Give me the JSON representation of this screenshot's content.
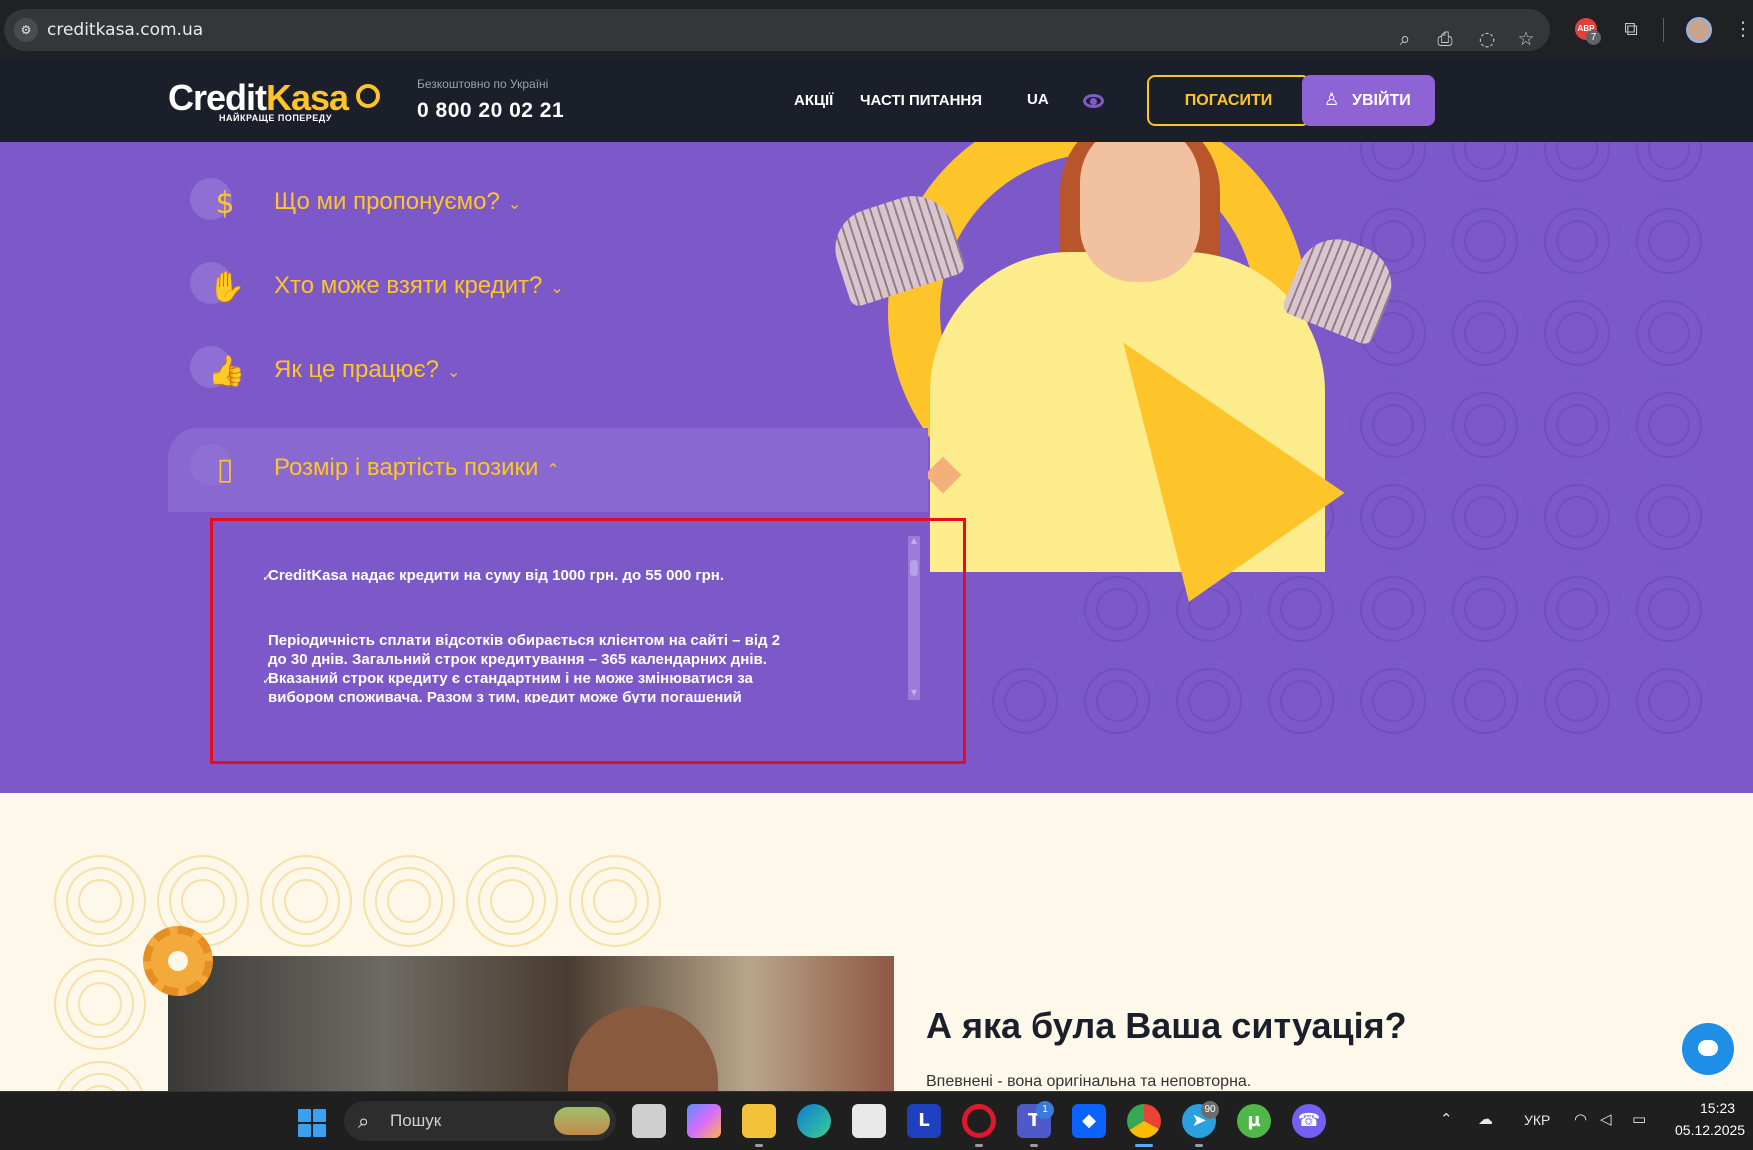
{
  "browser": {
    "url": "creditkasa.com.ua",
    "extension_badge_label": "ABP",
    "extension_badge_count": "7"
  },
  "header": {
    "logo_credit": "Credit",
    "logo_kasa": "Kasa",
    "logo_tagline": "НАЙКРАЩЕ ПОПЕРЕДУ",
    "free_label": "Безкоштовно по Україні",
    "phone": "0 800 20 02 21",
    "nav": [
      "АКЦІЇ",
      "ЧАСТІ ПИТАННЯ"
    ],
    "language": "UA",
    "pay_button": "ПОГАСИТИ",
    "login_button": "УВІЙТИ"
  },
  "accordion": {
    "items": [
      {
        "title": "Що ми пропонуємо?",
        "icon": "money-bag-icon",
        "expanded": false
      },
      {
        "title": "Хто може взяти кредит?",
        "icon": "hand-coin-icon",
        "expanded": false
      },
      {
        "title": "Як це працює?",
        "icon": "thumbs-up-coin-icon",
        "expanded": false
      },
      {
        "title": "Розмір і вартість позики",
        "icon": "phone-coin-icon",
        "expanded": true
      }
    ],
    "panel": {
      "line1": "CreditKasa надає кредити на суму від 1000 грн. до 55 000 грн.",
      "line2a": "Періодичність сплати відсотків обирається клієнтом на сайті – від 2",
      "line2b": "до 30 днів. Загальний строк кредитування – 365 календарних днів.",
      "line2c": "Вказаний строк кредиту є стандартним і не може змінюватися за",
      "line2d": "вибором споживача. Разом з тим, кредит може бути погашений"
    }
  },
  "situation": {
    "title": "А яка була Ваша ситуація?",
    "subtitle": "Впевнені - вона оригінальна та неповторна."
  },
  "taskbar": {
    "search_label": "Пошук",
    "teams_badge": "1",
    "telegram_badge": "90",
    "language": "УКР",
    "time": "15:23",
    "date": "05.12.2025"
  },
  "colors": {
    "brand_yellow": "#fdc52a",
    "hero_purple": "#7d58c8",
    "header_dark": "#1b1f2a",
    "highlight_red": "#e30d1b"
  }
}
